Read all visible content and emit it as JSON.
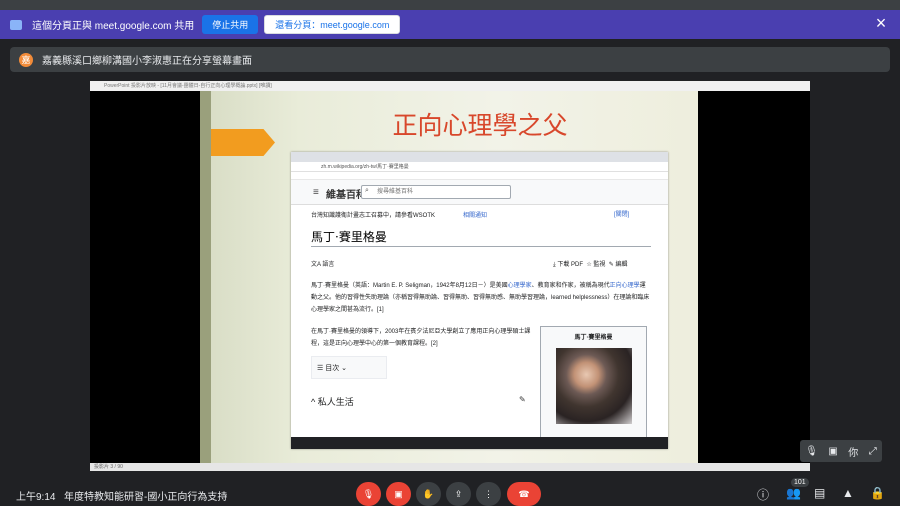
{
  "share_bar": {
    "text": "這個分頁正與 meet.google.com 共用",
    "stop": "停止共用",
    "show": "還看分頁：meet.google.com"
  },
  "presenter": {
    "initial": "嘉",
    "label": "嘉義縣溪口鄉柳溝國小李淑惠正在分享螢幕畫面"
  },
  "ppt": {
    "window_title": "PowerPoint 投影片放映 - [11月會議-團體日-自行正向心理學概論.pptx] [唯讀]",
    "status": "投影片 3 / 90"
  },
  "slide": {
    "title": "正向心理學之父"
  },
  "browser": {
    "address": "zh.m.wikipedia.org/zh-tw/馬丁·賽里格曼"
  },
  "wiki": {
    "logo": "維基百科",
    "search_placeholder": "搜尋維基百科",
    "notice": "台灣知識護衛計畫志工召募中，請參看WSOTK",
    "notice_link": "相關通知",
    "close": "[關閉]",
    "title": "馬丁·賽里格曼",
    "lang": "語言",
    "download": "下載 PDF",
    "watch": "監視",
    "edit": "編輯",
    "para1_text": "馬丁·賽里格曼（英語：Martin E. P. Seligman，1942年8月12日－）是美國",
    "para1_link1": "心理學家",
    "para1_mid": "、教育家和作家，被稱為現代",
    "para1_link2": "正向心理學",
    "para1_end": "運動之父。他的習得性失助理論（亦稱習得無助論、習得無助、習得無助感、無助學習理論，learned helplessness）在理論和臨床心理學家之間甚為流行。[1]",
    "para2": "在馬丁·賽里格曼的領導下，2003年在賓夕法尼亞大學創立了應用正向心理學碩士課程，這是正向心理學中心的第一個教育課程。[2]",
    "toc": "目次",
    "section": "私人生活",
    "infobox_title": "馬丁·賽里格曼"
  },
  "meet": {
    "time": "上午9:14",
    "meeting_name": "年度特教知能研習-國小正向行為支持",
    "participants": "101",
    "pip_label": "你"
  }
}
